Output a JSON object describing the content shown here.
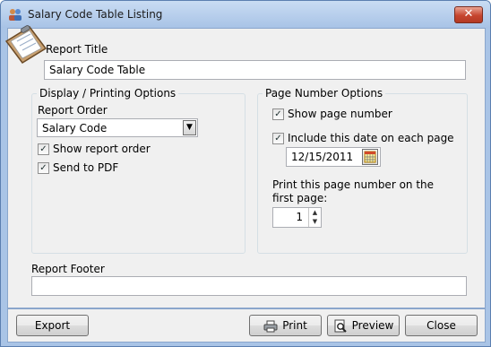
{
  "window": {
    "title": "Salary Code Table Listing",
    "close_glyph": "✕"
  },
  "report_title": {
    "label": "Report Title",
    "value": "Salary Code Table"
  },
  "display_options": {
    "group_title": "Display / Printing Options",
    "report_order_label": "Report Order",
    "report_order_value": "Salary Code",
    "show_report_order": {
      "label": "Show report order",
      "checked": true
    },
    "send_to_pdf": {
      "label": "Send to PDF",
      "checked": true
    }
  },
  "page_number_options": {
    "group_title": "Page Number Options",
    "show_page_number": {
      "label": "Show page number",
      "checked": true
    },
    "include_date": {
      "label": "Include this date on each page",
      "checked": true
    },
    "date_value": "12/15/2011",
    "first_page_label_line1": "Print this page number on the",
    "first_page_label_line2": "first page:",
    "first_page_value": "1"
  },
  "report_footer": {
    "label": "Report Footer",
    "value": ""
  },
  "buttons": {
    "export": "Export",
    "print": "Print",
    "preview": "Preview",
    "close": "Close"
  },
  "check_glyph": "✓",
  "icons": {
    "app": "clipboard-people-icon",
    "clipboard": "clipboard-icon",
    "calendar": "calendar-icon",
    "printer": "printer-icon",
    "preview": "magnifier-page-icon"
  },
  "colors": {
    "frame": "#a9c4e6",
    "client": "#f0f0f0",
    "close_button": "#c6452f"
  }
}
